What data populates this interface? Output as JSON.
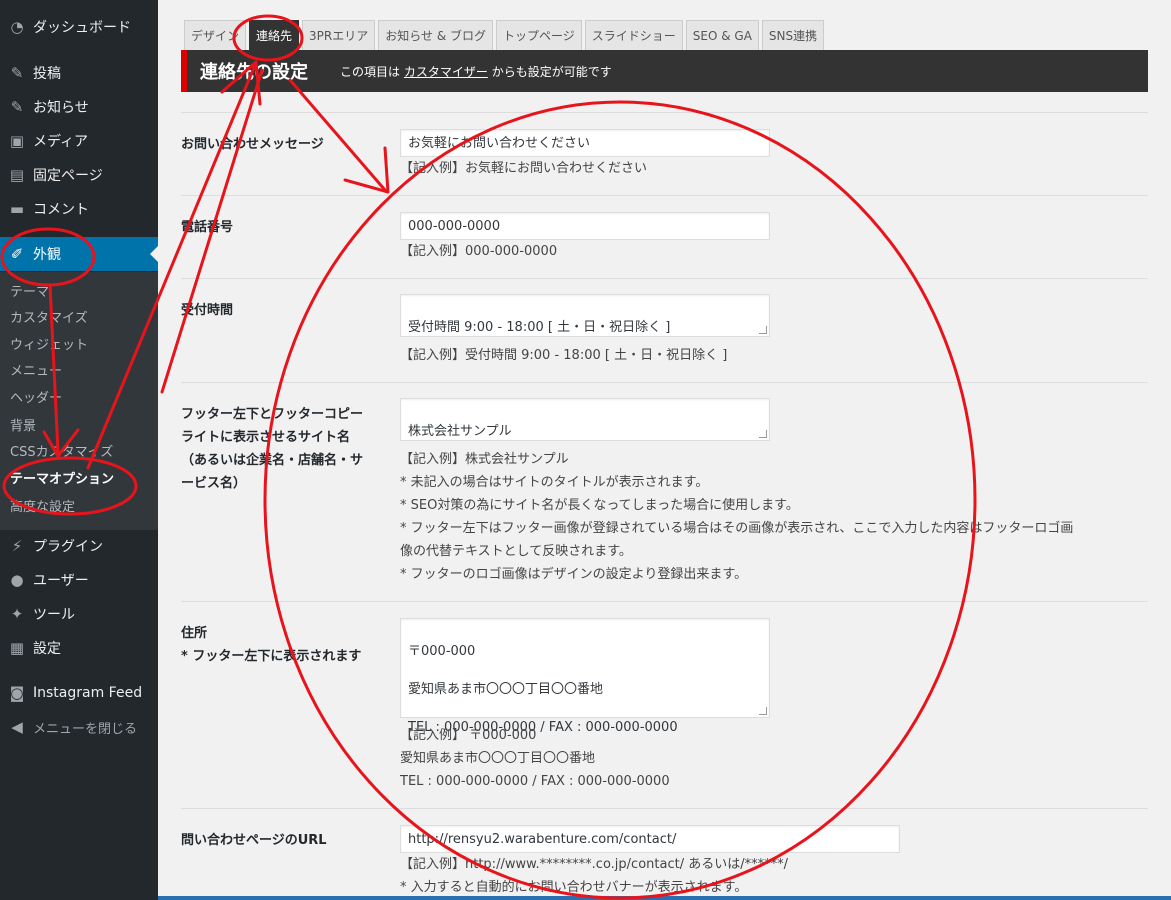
{
  "sidebar": {
    "items": [
      {
        "label": "ダッシュボード",
        "icon": "dashboard-icon"
      },
      {
        "label": "投稿",
        "icon": "pin-icon"
      },
      {
        "label": "お知らせ",
        "icon": "pin-icon"
      },
      {
        "label": "メディア",
        "icon": "media-icon"
      },
      {
        "label": "固定ページ",
        "icon": "page-icon"
      },
      {
        "label": "コメント",
        "icon": "comment-icon"
      },
      {
        "label": "外観",
        "icon": "brush-icon"
      }
    ],
    "submenu": [
      "テーマ",
      "カスタマイズ",
      "ウィジェット",
      "メニュー",
      "ヘッダー",
      "背景",
      "CSSカスタマイズ",
      "テーマオプション",
      "高度な設定"
    ],
    "items_after": [
      {
        "label": "プラグイン",
        "icon": "plugin-icon"
      },
      {
        "label": "ユーザー",
        "icon": "user-icon"
      },
      {
        "label": "ツール",
        "icon": "wrench-icon"
      },
      {
        "label": "設定",
        "icon": "settings-icon"
      },
      {
        "label": "Instagram Feed",
        "icon": "camera-icon"
      },
      {
        "label": "メニューを閉じる",
        "icon": "collapse-icon"
      }
    ]
  },
  "tabs": [
    "デザイン",
    "連絡先",
    "3PRエリア",
    "お知らせ & ブログ",
    "トップページ",
    "スライドショー",
    "SEO & GA",
    "SNS連携"
  ],
  "section": {
    "title": "連絡先の設定",
    "note_prefix": "この項目は",
    "note_link": "カスタマイザー",
    "note_suffix": "からも設定が可能です"
  },
  "form": {
    "message": {
      "label": "お問い合わせメッセージ",
      "value": "お気軽にお問い合わせください",
      "example": "【記入例】お気軽にお問い合わせください"
    },
    "phone": {
      "label": "電話番号",
      "value": "000-000-0000",
      "example": "【記入例】000-000-0000"
    },
    "hours": {
      "label": "受付時間",
      "value": "受付時間 9:00 - 18:00 [ 土・日・祝日除く ]",
      "example": "【記入例】受付時間 9:00 - 18:00 [ 土・日・祝日除く ]"
    },
    "site_name": {
      "label_lines": [
        "フッター左下とフッターコピー",
        "ライトに表示させるサイト名",
        "（あるいは企業名・店舗名・サ",
        "ービス名）"
      ],
      "value": "株式会社サンプル",
      "example_lines": [
        "【記入例】株式会社サンプル",
        "* 未記入の場合はサイトのタイトルが表示されます。",
        "* SEO対策の為にサイト名が長くなってしまった場合に使用します。",
        "* フッター左下はフッター画像が登録されている場合はその画像が表示され、ここで入力した内容はフッターロゴ画",
        "像の代替テキストとして反映されます。",
        "* フッターのロゴ画像はデザインの設定より登録出来ます。"
      ]
    },
    "address": {
      "label_lines": [
        "住所",
        "* フッター左下に表示されます"
      ],
      "value_lines": [
        "〒000-000",
        "愛知県あま市〇〇〇丁目〇〇番地",
        "TEL : 000-000-0000 / FAX : 000-000-0000"
      ],
      "example_lines": [
        "【記入例】 〒000-000",
        "愛知県あま市〇〇〇丁目〇〇番地",
        "TEL : 000-000-0000 / FAX : 000-000-0000"
      ]
    },
    "contact_url": {
      "label": "問い合わせページのURL",
      "value": "http://rensyu2.warabenture.com/contact/",
      "example_lines": [
        "【記入例】http://www.********.co.jp/contact/ あるいは/******/",
        "* 入力すると自動的にお問い合わせバナーが表示されます。"
      ]
    }
  },
  "colors": {
    "sidebar_bg": "#23282d",
    "active_menu": "#0073aa",
    "header_bg": "#333333",
    "accent_red": "#dd0000",
    "annotation": "#e8141c"
  }
}
